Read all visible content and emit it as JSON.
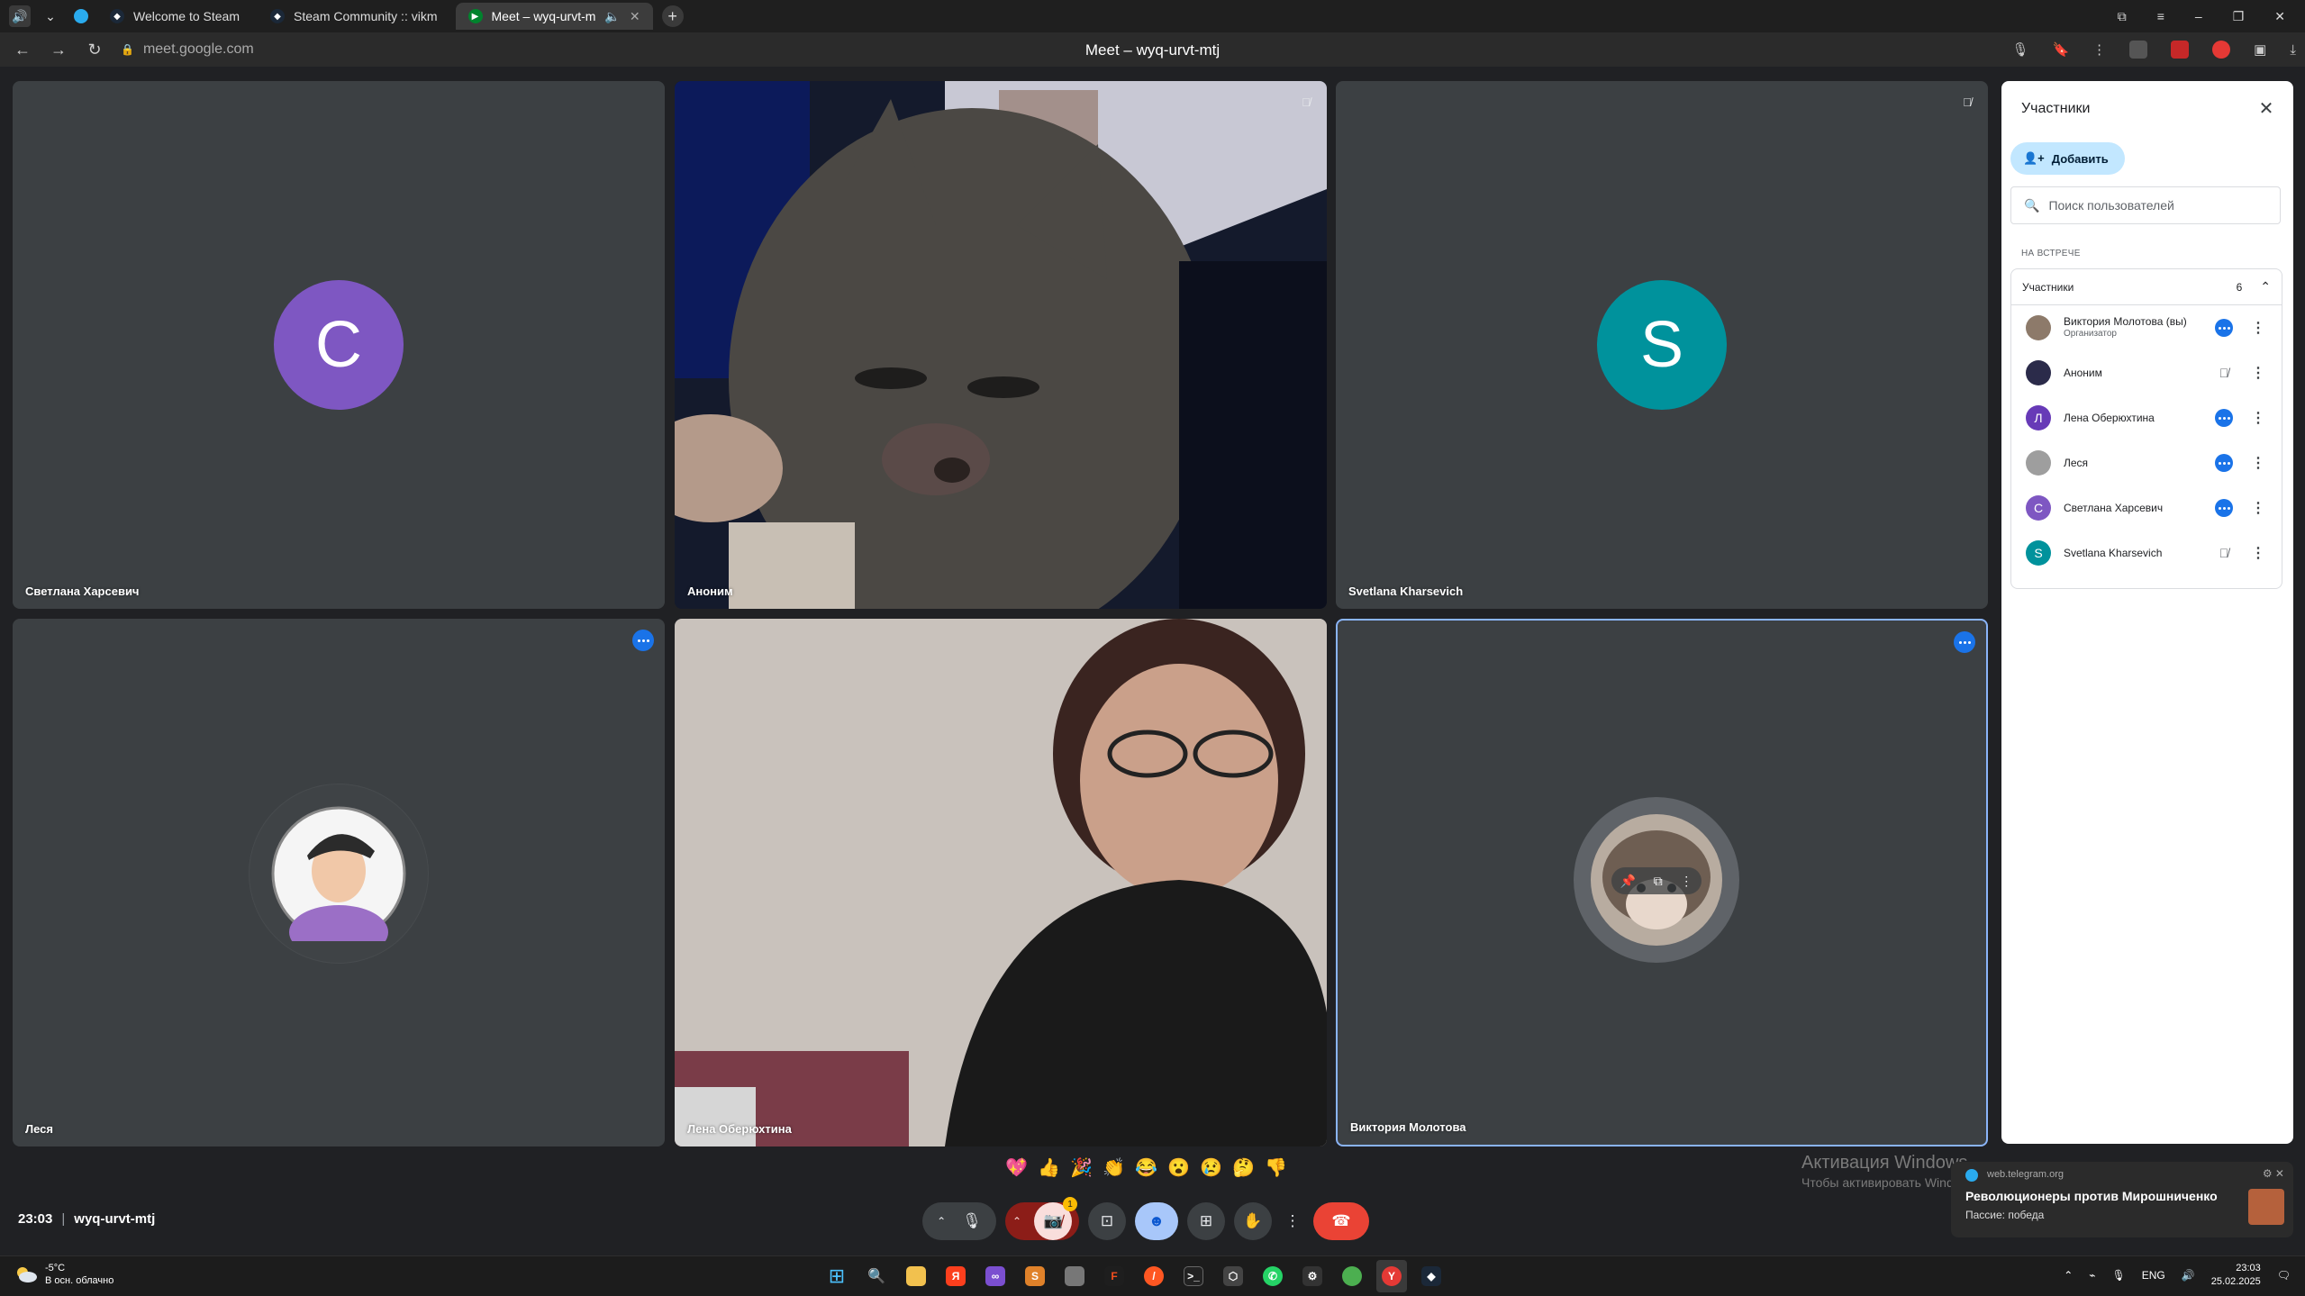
{
  "browser": {
    "tabs": [
      {
        "label": "Welcome to Steam",
        "active": false
      },
      {
        "label": "Steam Community :: vikm",
        "active": false
      },
      {
        "label": "Meet – wyq-urvt-m",
        "active": true
      }
    ],
    "url": "meet.google.com",
    "page_title": "Meet – wyq-urvt-mtj"
  },
  "tiles": [
    {
      "name": "Светлана Харсевич",
      "letter": "C",
      "color": "#7e57c2"
    },
    {
      "name": "Аноним"
    },
    {
      "name": "Svetlana Kharsevich",
      "letter": "S",
      "color": "#00929c"
    },
    {
      "name": "Леся"
    },
    {
      "name": "Лена Оберюхтина"
    },
    {
      "name": "Виктория Молотова"
    }
  ],
  "panel": {
    "title": "Участники",
    "add_label": "Добавить",
    "search_placeholder": "Поиск пользователей",
    "section_label": "НА ВСТРЕЧЕ",
    "group_label": "Участники",
    "group_count": "6",
    "participants": [
      {
        "name": "Виктория Молотова (вы)",
        "sub": "Организатор",
        "status": "speaking",
        "avatar_color": "#8d7a6a",
        "letter": ""
      },
      {
        "name": "Аноним",
        "sub": "",
        "status": "muted",
        "avatar_color": "#2b2b4a",
        "letter": ""
      },
      {
        "name": "Лена Оберюхтина",
        "sub": "",
        "status": "speaking",
        "avatar_color": "#673ab7",
        "letter": "Л"
      },
      {
        "name": "Леся",
        "sub": "",
        "status": "active",
        "avatar_color": "#9e9e9e",
        "letter": ""
      },
      {
        "name": "Светлана Харсевич",
        "sub": "",
        "status": "speaking",
        "avatar_color": "#7e57c2",
        "letter": "С"
      },
      {
        "name": "Svetlana Kharsevich",
        "sub": "",
        "status": "muted",
        "avatar_color": "#00929c",
        "letter": "S"
      }
    ]
  },
  "reactions": [
    "💖",
    "👍",
    "🎉",
    "👏",
    "😂",
    "😮",
    "😢",
    "🤔",
    "👎"
  ],
  "meeting": {
    "time": "23:03",
    "code": "wyq-urvt-mtj"
  },
  "controls": {
    "notification_badge": "1"
  },
  "watermark": {
    "line1": "Активация Windows",
    "line2": "Чтобы активировать Windows, перейдите в раздел \"Параметры\"."
  },
  "toast": {
    "source": "web.telegram.org",
    "title": "Революционеры против Мирошниченко",
    "text": "Пассие: победа"
  },
  "taskbar": {
    "weather_temp": "-5°C",
    "weather_desc": "В осн. облачно",
    "lang": "ENG",
    "time": "23:03",
    "date": "25.02.2025"
  }
}
